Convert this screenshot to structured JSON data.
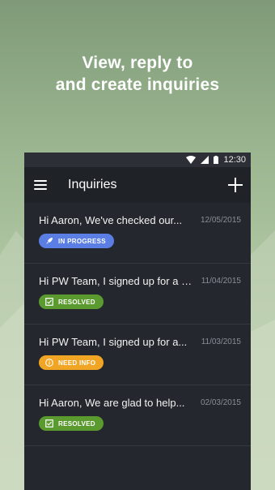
{
  "promo": {
    "line1": "View, reply to",
    "line2": "and create inquiries"
  },
  "status_bar": {
    "time": "12:30",
    "icons": [
      "wifi-icon",
      "signal-icon",
      "battery-icon"
    ]
  },
  "app_bar": {
    "title": "Inquiries",
    "menu_icon": "hamburger-menu-icon",
    "add_icon": "plus-icon"
  },
  "colors": {
    "in_progress": "#5b7ee5",
    "resolved": "#5b9a2e",
    "need_info": "#f0a524"
  },
  "inquiries": [
    {
      "message": "Hi Aaron, We've checked our...",
      "date": "12/05/2015",
      "status": "IN PROGRESS",
      "status_icon": "rocket-icon"
    },
    {
      "message": "Hi PW Team, I signed up for a 15...",
      "date": "11/04/2015",
      "status": "RESOLVED",
      "status_icon": "check-box-icon"
    },
    {
      "message": "Hi PW Team, I signed up for a...",
      "date": "11/03/2015",
      "status": "NEED INFO",
      "status_icon": "info-icon"
    },
    {
      "message": "Hi Aaron, We are glad to help...",
      "date": "02/03/2015",
      "status": "RESOLVED",
      "status_icon": "check-box-icon"
    }
  ]
}
